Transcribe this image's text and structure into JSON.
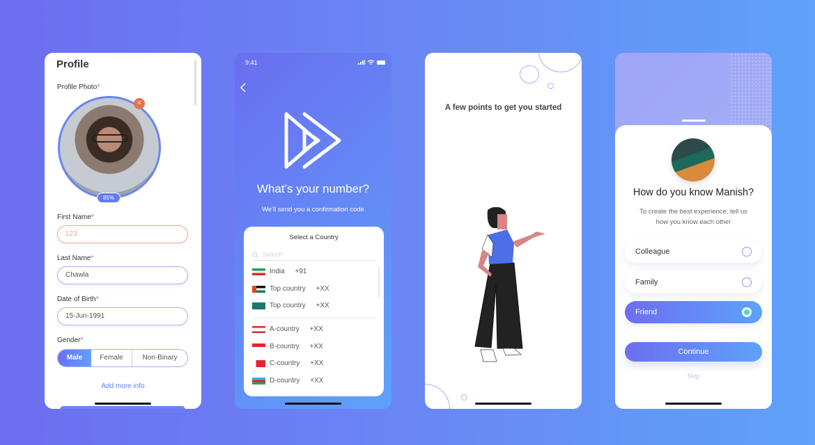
{
  "profile": {
    "title": "Profile",
    "photo_label": "Profile Photo",
    "required_mark": "*",
    "upload_progress": "85%",
    "first_name_label": "First Name",
    "first_name_value": "123",
    "last_name_label": "Last Name",
    "last_name_value": "Chawla",
    "dob_label": "Date of Birth",
    "dob_value": "15-Jun-1991",
    "gender_label": "Gender",
    "gender_options": [
      "Male",
      "Female",
      "Non-Binary"
    ],
    "gender_selected": "Male",
    "add_more": "Add more info",
    "error_color": "#f3a487",
    "accent": "#6c6ef0"
  },
  "phone": {
    "time": "9:41",
    "title": "What’s your number?",
    "subtitle": "We'll send you a confirmation code",
    "picker_title": "Select a Country",
    "search_placeholder": "Search",
    "top_countries": [
      {
        "name": "India",
        "code": "+91"
      },
      {
        "name": "Top country",
        "code": "+XX"
      },
      {
        "name": "Top country",
        "code": "+XX"
      }
    ],
    "countries": [
      {
        "name": "A-country",
        "code": "+XX"
      },
      {
        "name": "B-country",
        "code": "+XX"
      },
      {
        "name": "C-country",
        "code": "+XX"
      },
      {
        "name": "D-country",
        "code": "+XX"
      }
    ]
  },
  "intro": {
    "title": "A few points to get you started"
  },
  "relation": {
    "title": "How do you know Manish?",
    "subtitle_line1": "To create the best experience, tell us",
    "subtitle_line2": "how you know each other",
    "options": [
      "Colleague",
      "Family",
      "Friend"
    ],
    "selected": "Friend",
    "continue": "Continue",
    "skip": "Skip",
    "selected_dot_color": "#3fe0c0"
  }
}
